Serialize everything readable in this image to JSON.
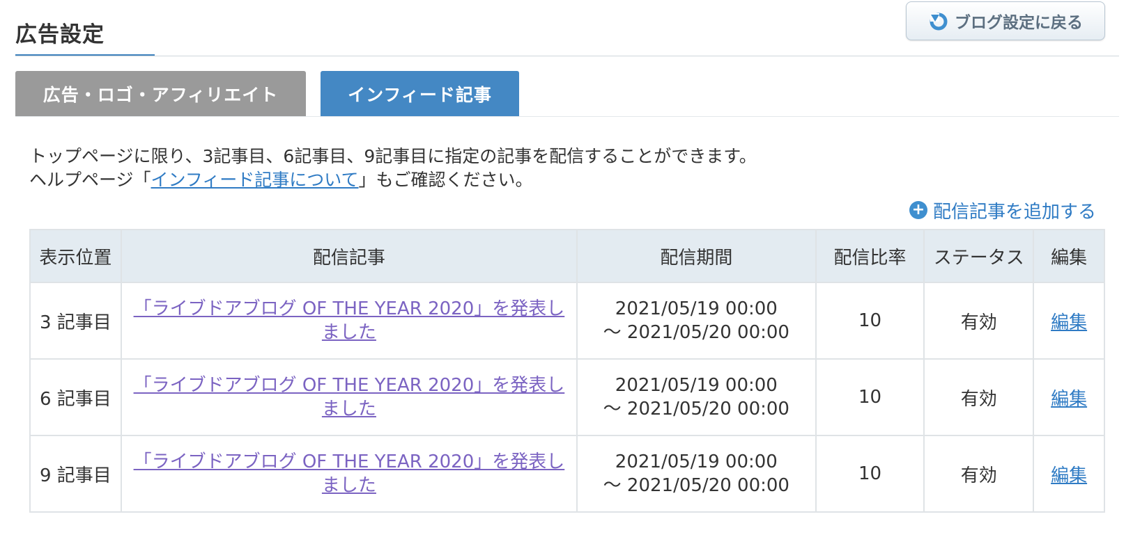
{
  "page": {
    "title": "広告設定",
    "back_button_label": "ブログ設定に戻る"
  },
  "tabs": [
    {
      "label": "広告・ロゴ・アフィリエイト",
      "active": false
    },
    {
      "label": "インフィード記事",
      "active": true
    }
  ],
  "description": {
    "line1": "トップページに限り、3記事目、6記事目、9記事目に指定の記事を配信することができます。",
    "line2_prefix": "ヘルプページ「",
    "line2_link": "インフィード記事について",
    "line2_suffix": "」もご確認ください。"
  },
  "add_link_label": "配信記事を追加する",
  "table": {
    "headers": [
      "表示位置",
      "配信記事",
      "配信期間",
      "配信比率",
      "ステータス",
      "編集"
    ],
    "rows": [
      {
        "position": "3 記事目",
        "article": "「ライブドアブログ OF THE YEAR 2020」を発表しました",
        "period_start": "2021/05/19 00:00",
        "period_end": "～ 2021/05/20 00:00",
        "ratio": "10",
        "status": "有効",
        "edit": "編集"
      },
      {
        "position": "6 記事目",
        "article": "「ライブドアブログ OF THE YEAR 2020」を発表しました",
        "period_start": "2021/05/19 00:00",
        "period_end": "～ 2021/05/20 00:00",
        "ratio": "10",
        "status": "有効",
        "edit": "編集"
      },
      {
        "position": "9 記事目",
        "article": "「ライブドアブログ OF THE YEAR 2020」を発表しました",
        "period_start": "2021/05/19 00:00",
        "period_end": "～ 2021/05/20 00:00",
        "ratio": "10",
        "status": "有効",
        "edit": "編集"
      }
    ]
  },
  "colors": {
    "accent": "#4488c4",
    "inactive_tab": "#9a9a9a",
    "link": "#2f7bc4",
    "visited_link": "#7b63c2",
    "header_bg": "#e3ebf1"
  },
  "icons": {
    "back": "refresh-arrow-icon",
    "add": "plus-circle-icon"
  }
}
